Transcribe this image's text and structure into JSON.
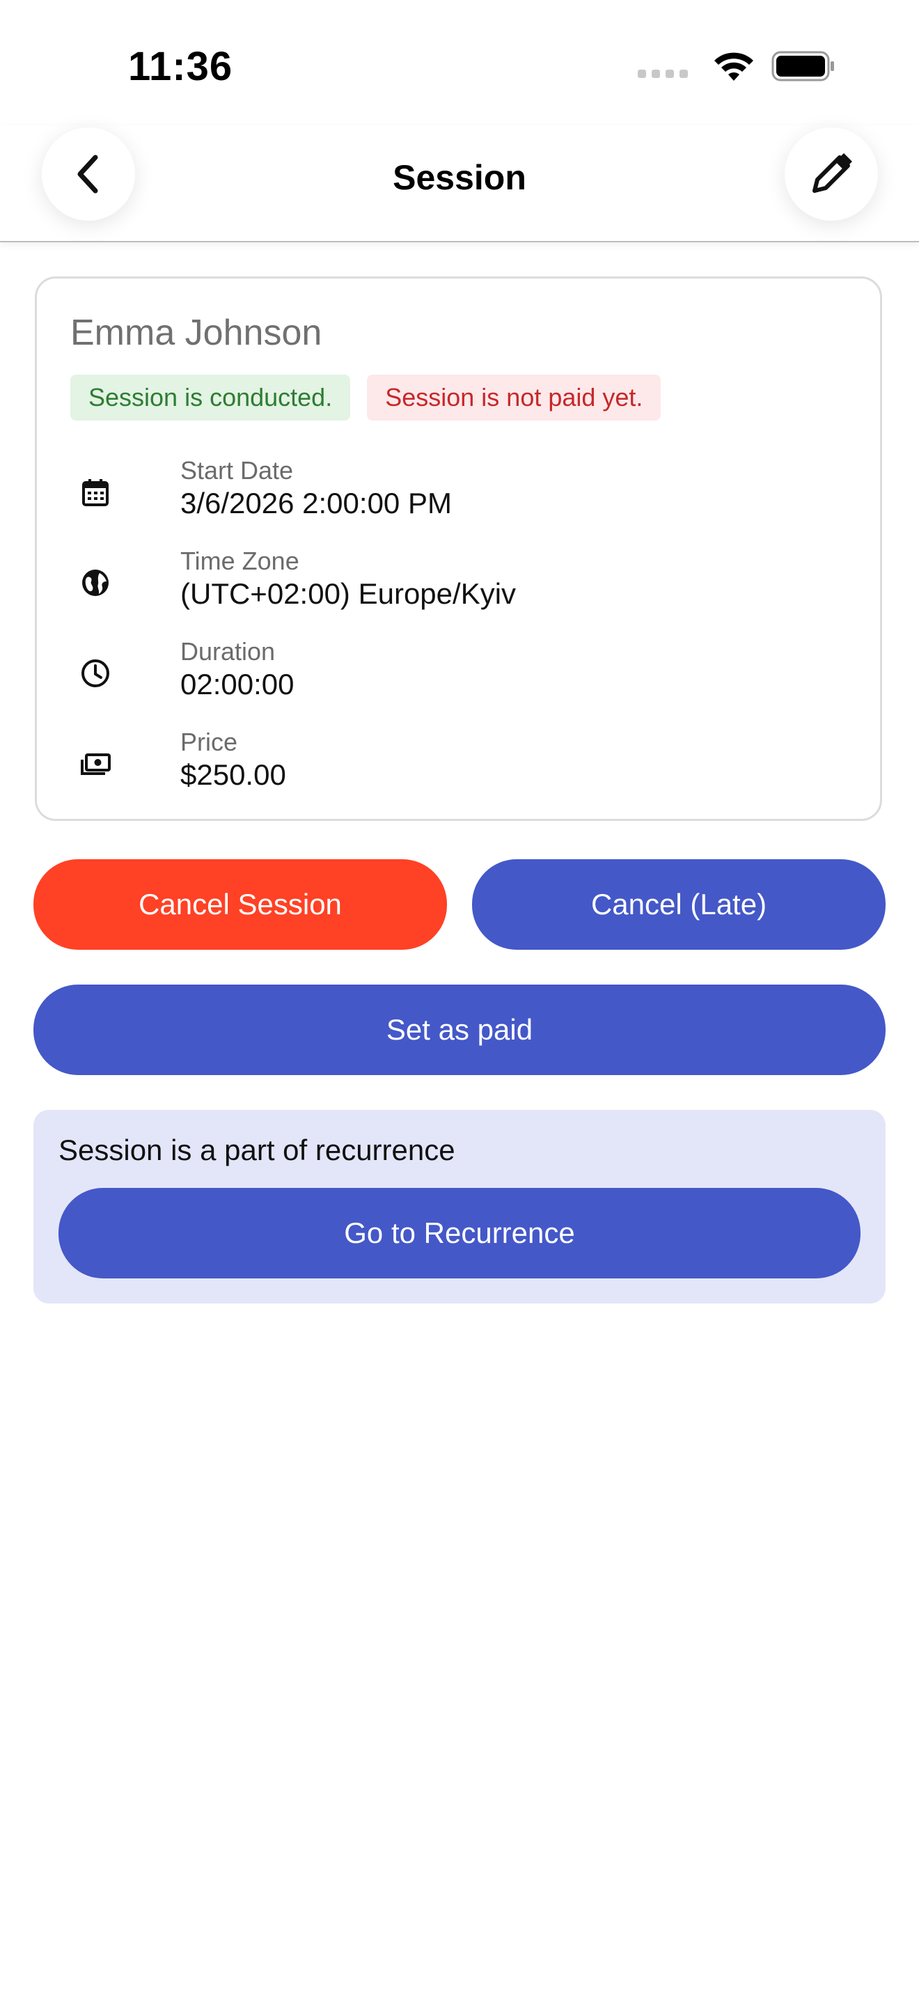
{
  "status_bar": {
    "time": "11:36",
    "icons": [
      "cellular-signal-icon",
      "wifi-icon",
      "battery-icon"
    ]
  },
  "header": {
    "title": "Session",
    "back_icon": "chevron-left-icon",
    "edit_icon": "pencil-icon"
  },
  "session": {
    "client_name": "Emma Johnson",
    "badges": {
      "conducted": "Session is conducted.",
      "payment": "Session is not paid yet."
    },
    "details": [
      {
        "icon": "calendar-icon",
        "label": "Start Date",
        "value": "3/6/2026 2:00:00 PM"
      },
      {
        "icon": "globe-icon",
        "label": "Time Zone",
        "value": "(UTC+02:00) Europe/Kyiv"
      },
      {
        "icon": "clock-icon",
        "label": "Duration",
        "value": "02:00:00"
      },
      {
        "icon": "money-icon",
        "label": "Price",
        "value": "$250.00"
      }
    ]
  },
  "actions": {
    "cancel_session": "Cancel Session",
    "cancel_late": "Cancel (Late)",
    "set_paid": "Set as paid"
  },
  "recurrence": {
    "text": "Session is a part of recurrence",
    "button": "Go to Recurrence"
  },
  "colors": {
    "primary": "#4458c8",
    "danger": "#ff4125",
    "recurrence_bg": "#e3e6f8",
    "badge_success_bg": "#e3f3e4",
    "badge_success_text": "#2e7d32",
    "badge_error_bg": "#fde8ea",
    "badge_error_text": "#c62828"
  }
}
